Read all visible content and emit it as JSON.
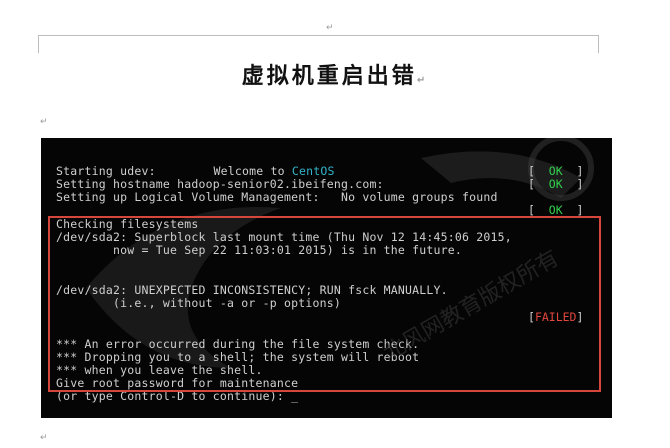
{
  "document": {
    "title": "虚拟机重启出错",
    "paragraph_mark": "↵",
    "small_mark": "↵"
  },
  "terminal": {
    "welcome_prefix": "Welcome to ",
    "welcome_os": "CentOS",
    "lines": [
      "Starting udev:",
      "Setting hostname hadoop-senior02.ibeifeng.com:",
      "Setting up Logical Volume Management:   No volume groups found",
      "Checking filesystems",
      "/dev/sda2: Superblock last mount time (Thu Nov 12 14:45:06 2015,",
      "        now = Tue Sep 22 11:03:01 2015) is in the future.",
      "/dev/sda2: UNEXPECTED INCONSISTENCY; RUN fsck MANUALLY.",
      "        (i.e., without -a or -p options)",
      "*** An error occurred during the file system check.",
      "*** Dropping you to a shell; the system will reboot",
      "*** when you leave the shell.",
      "Give root password for maintenance",
      "(or type Control-D to continue): _"
    ],
    "ok_label": "OK",
    "failed_label": "FAILED",
    "bracket_open": "[",
    "bracket_close": "]",
    "colors": {
      "ok": "#31d14d",
      "failed": "#e2463c",
      "os_name": "#33b4c8",
      "highlight_border": "#d7463c"
    }
  },
  "watermark": {
    "text": "北风网教育版权所有"
  }
}
